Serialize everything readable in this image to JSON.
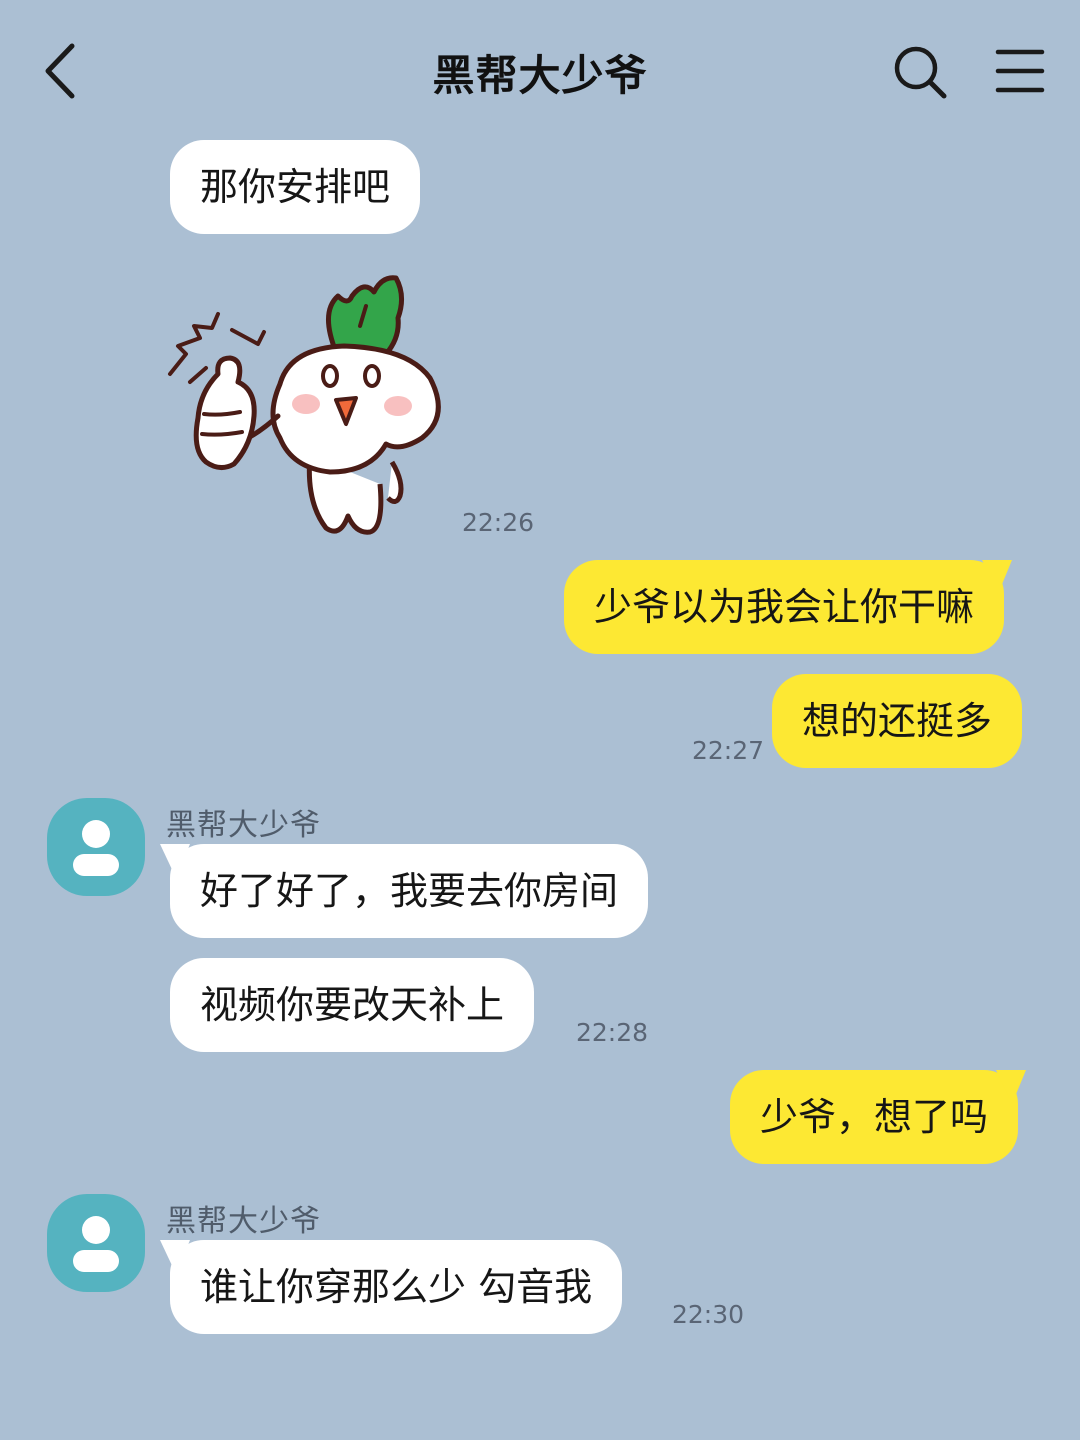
{
  "header": {
    "title": "黑帮大少爷",
    "back_icon": "chevron-left-icon",
    "search_icon": "search-icon",
    "menu_icon": "menu-icon"
  },
  "colors": {
    "background": "#abbfd3",
    "incoming_bubble": "#ffffff",
    "outgoing_bubble": "#fde833",
    "avatar": "#55b3c0"
  },
  "messages": [
    {
      "direction": "in",
      "text": "那你安排吧"
    },
    {
      "direction": "in",
      "type": "sticker",
      "sticker": "radish-thumbs-up-sticker",
      "time": "22:26"
    },
    {
      "direction": "out",
      "text": "少爷以为我会让你干嘛"
    },
    {
      "direction": "out",
      "text": "想的还挺多",
      "time": "22:27"
    },
    {
      "direction": "in",
      "sender": "黑帮大少爷",
      "text": "好了好了，我要去你房间"
    },
    {
      "direction": "in",
      "text": "视频你要改天补上",
      "time": "22:28"
    },
    {
      "direction": "out",
      "text": "少爷，想了吗"
    },
    {
      "direction": "in",
      "sender": "黑帮大少爷",
      "text": "谁让你穿那么少 勾音我",
      "time": "22:30"
    }
  ]
}
